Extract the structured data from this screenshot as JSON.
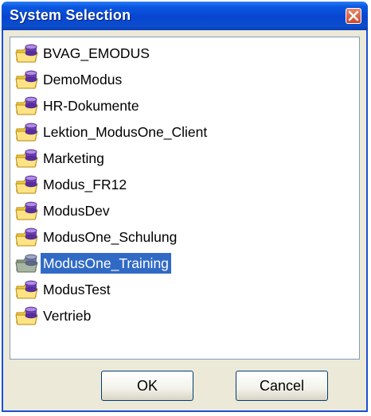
{
  "window": {
    "title": "System Selection"
  },
  "tree": {
    "items": [
      {
        "label": "BVAG_EMODUS",
        "icon": "database-folder-icon",
        "selected": false
      },
      {
        "label": "DemoModus",
        "icon": "database-folder-icon",
        "selected": false
      },
      {
        "label": "HR-Dokumente",
        "icon": "database-folder-icon",
        "selected": false
      },
      {
        "label": "Lektion_ModusOne_Client",
        "icon": "database-folder-icon",
        "selected": false
      },
      {
        "label": "Marketing",
        "icon": "database-folder-icon",
        "selected": false
      },
      {
        "label": "Modus_FR12",
        "icon": "database-folder-icon",
        "selected": false
      },
      {
        "label": "ModusDev",
        "icon": "database-folder-icon",
        "selected": false
      },
      {
        "label": "ModusOne_Schulung",
        "icon": "database-folder-icon",
        "selected": false
      },
      {
        "label": "ModusOne_Training",
        "icon": "database-folder-icon",
        "selected": true
      },
      {
        "label": "ModusTest",
        "icon": "database-folder-icon",
        "selected": false
      },
      {
        "label": "Vertrieb",
        "icon": "database-folder-icon",
        "selected": false
      }
    ]
  },
  "buttons": {
    "ok": "OK",
    "cancel": "Cancel"
  },
  "colors": {
    "titlebar": "#0845d0",
    "selection": "#316ac5",
    "close": "#d0472a",
    "face": "#ece9d8"
  }
}
